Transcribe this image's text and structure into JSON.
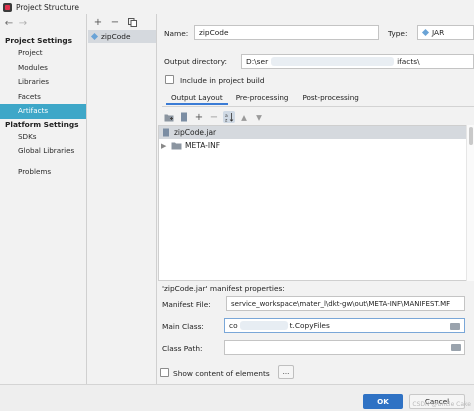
{
  "window": {
    "title": "Project Structure"
  },
  "left_nav": {
    "project_settings_heading": "Project Settings",
    "project_settings_items": [
      {
        "label": "Project",
        "selected": false
      },
      {
        "label": "Modules",
        "selected": false
      },
      {
        "label": "Libraries",
        "selected": false
      },
      {
        "label": "Facets",
        "selected": false
      },
      {
        "label": "Artifacts",
        "selected": true
      }
    ],
    "platform_settings_heading": "Platform Settings",
    "platform_settings_items": [
      {
        "label": "SDKs"
      },
      {
        "label": "Global Libraries"
      }
    ],
    "problems_label": "Problems"
  },
  "artifacts_list": {
    "items": [
      {
        "label": "zipCode",
        "selected": true
      }
    ]
  },
  "artifact": {
    "name_label": "Name:",
    "name_value": "zipCode",
    "type_label": "Type:",
    "type_value": "JAR",
    "output_dir_label": "Output directory:",
    "output_dir_value": "D:\\ser",
    "output_dir_tail": "ifacts\\",
    "include_in_build_label": "Include in project build",
    "include_in_build_checked": false
  },
  "tabs": [
    {
      "label": "Output Layout",
      "active": true
    },
    {
      "label": "Pre-processing",
      "active": false
    },
    {
      "label": "Post-processing",
      "active": false
    }
  ],
  "layout_tree": [
    {
      "label": "zipCode.jar",
      "type": "jar"
    },
    {
      "label": "META-INF",
      "type": "folder"
    }
  ],
  "manifest": {
    "heading": "'zipCode.jar' manifest properties:",
    "file_label": "Manifest File:",
    "file_value": "service_workspace\\mater_l\\dkt-gw\\out\\META-INF\\MANIFEST.MF",
    "main_class_label": "Main Class:",
    "main_class_prefix": "co",
    "main_class_suffix": "t.CopyFiles",
    "class_path_label": "Class Path:",
    "class_path_value": "",
    "show_content_label": "Show content of elements",
    "show_content_checked": false,
    "more_button": "..."
  },
  "buttons": {
    "ok": "OK",
    "cancel": "Cancel"
  },
  "watermark": "CSDN @Uncle Cake"
}
